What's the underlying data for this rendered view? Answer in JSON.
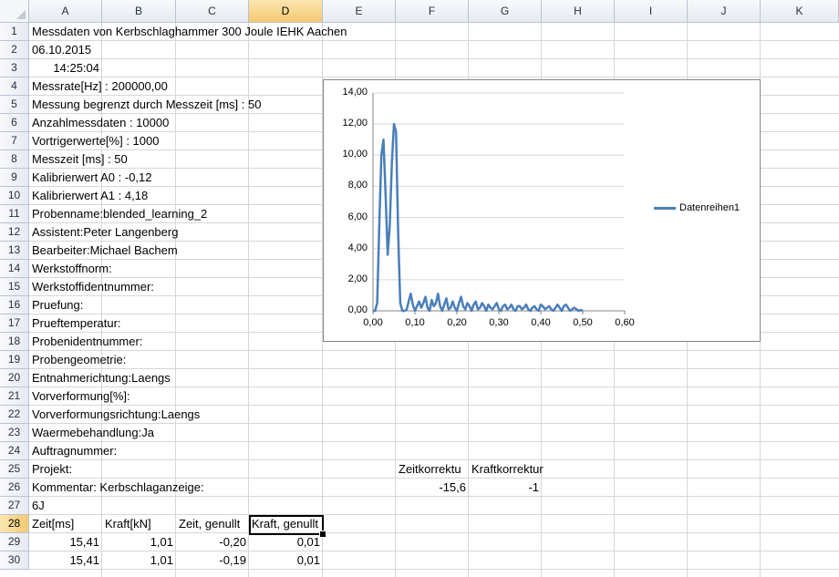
{
  "column_headers": [
    "A",
    "B",
    "C",
    "D",
    "E",
    "F",
    "G",
    "H",
    "I",
    "J",
    "K"
  ],
  "selected_column": "D",
  "row_numbers": [
    "1",
    "2",
    "3",
    "4",
    "5",
    "6",
    "7",
    "8",
    "9",
    "10",
    "11",
    "12",
    "13",
    "14",
    "15",
    "16",
    "17",
    "18",
    "19",
    "20",
    "21",
    "22",
    "23",
    "24",
    "25",
    "26",
    "27",
    "28",
    "29",
    "30"
  ],
  "selected_row": "28",
  "cells": {
    "A1": "Messdaten von Kerbschlaghammer 300 Joule IEHK Aachen",
    "A2": "06.10.2015",
    "A3": "14:25:04",
    "A4": "Messrate[Hz] : 200000,00",
    "A5": "Messung begrenzt durch Messzeit [ms] : 50",
    "A6": "Anzahlmessdaten : 10000",
    "A7": "Vortrigerwerte[%] : 1000",
    "A8": "Messzeit [ms] : 50",
    "A9": "Kalibrierwert A0 : -0,12",
    "A10": "Kalibrierwert A1 : 4,18",
    "A11": "Probenname:blended_learning_2",
    "A12": "Assistent:Peter Langenberg",
    "A13": "Bearbeiter:Michael Bachem",
    "A14": "Werkstoffnorm:",
    "A15": "Werkstoffidentnummer:",
    "A16": "Pruefung:",
    "A17": "Prueftemperatur:",
    "A18": "Probenidentnummer:",
    "A19": "Probengeometrie:",
    "A20": "Entnahmerichtung:Laengs",
    "A21": "Vorverformung[%]:",
    "A22": "Vorverformungsrichtung:Laengs",
    "A23": "Waermebehandlung:Ja",
    "A24": "Auftragnummer:",
    "A25": "Projekt:",
    "F25": "Zeitkorrektu",
    "G25": "Kraftkorrektur",
    "A26": "Kommentar: Kerbschlaganzeige:",
    "F26": "-15,6",
    "G26": "-1",
    "A27": "6J",
    "A28": "Zeit[ms]",
    "B28": "Kraft[kN]",
    "C28": "Zeit, genullt",
    "D28": "Kraft, genullt",
    "A29": "15,41",
    "B29": "1,01",
    "C29": "-0,20",
    "D29": "0,01",
    "A30": "15,41",
    "B30": "1,01",
    "C30": "-0,19",
    "D30": "0,01"
  },
  "chart_data": {
    "type": "line",
    "title": "",
    "xlabel": "",
    "ylabel": "",
    "xlim": [
      0,
      0.6
    ],
    "ylim": [
      0,
      14
    ],
    "x_ticks": [
      "0,00",
      "0,10",
      "0,20",
      "0,30",
      "0,40",
      "0,50",
      "0,60"
    ],
    "y_ticks": [
      "0,00",
      "2,00",
      "4,00",
      "6,00",
      "8,00",
      "10,00",
      "12,00",
      "14,00"
    ],
    "legend_position": "right",
    "series": [
      {
        "name": "Datenreihen1",
        "color": "#4a7ebb",
        "x": [
          0,
          0.005,
          0.01,
          0.015,
          0.02,
          0.025,
          0.03,
          0.035,
          0.04,
          0.045,
          0.05,
          0.055,
          0.06,
          0.065,
          0.07,
          0.075,
          0.08,
          0.085,
          0.09,
          0.095,
          0.1,
          0.105,
          0.11,
          0.115,
          0.12,
          0.125,
          0.13,
          0.135,
          0.14,
          0.145,
          0.15,
          0.155,
          0.16,
          0.165,
          0.17,
          0.175,
          0.18,
          0.185,
          0.19,
          0.195,
          0.2,
          0.205,
          0.21,
          0.215,
          0.22,
          0.225,
          0.23,
          0.235,
          0.24,
          0.245,
          0.25,
          0.255,
          0.26,
          0.265,
          0.27,
          0.275,
          0.28,
          0.285,
          0.29,
          0.295,
          0.3,
          0.305,
          0.31,
          0.315,
          0.32,
          0.325,
          0.33,
          0.335,
          0.34,
          0.345,
          0.35,
          0.355,
          0.36,
          0.365,
          0.37,
          0.375,
          0.38,
          0.385,
          0.39,
          0.395,
          0.4,
          0.405,
          0.41,
          0.415,
          0.42,
          0.425,
          0.43,
          0.435,
          0.44,
          0.445,
          0.45,
          0.455,
          0.46,
          0.465,
          0.47,
          0.475,
          0.48,
          0.485,
          0.49,
          0.495,
          0.5
        ],
        "y": [
          0,
          0,
          0.5,
          5.5,
          10.0,
          11.0,
          7.5,
          3.6,
          5.5,
          9.5,
          12.0,
          11.5,
          5.0,
          0.5,
          0,
          0,
          0.05,
          0.6,
          1.1,
          0.4,
          0,
          0.3,
          0.6,
          0.2,
          0.5,
          0.9,
          0.2,
          0,
          0.7,
          0.3,
          0.5,
          1.1,
          0.3,
          0,
          0.4,
          0.8,
          0.1,
          0.2,
          0.6,
          0.2,
          0,
          0.5,
          0.9,
          0.3,
          0.1,
          0.5,
          0.3,
          0,
          0.4,
          0.6,
          0.1,
          0.2,
          0.5,
          0.3,
          0,
          0.4,
          0.2,
          0.1,
          0.3,
          0.5,
          0.1,
          0,
          0.3,
          0.4,
          0.1,
          0.2,
          0.4,
          0.1,
          0,
          0.3,
          0.3,
          0.1,
          0.2,
          0.4,
          0.1,
          0,
          0.2,
          0.3,
          0.1,
          0,
          0.4,
          0.3,
          0.1,
          0.2,
          0.3,
          0.1,
          0,
          0.2,
          0.4,
          0.2,
          0,
          0.3,
          0.4,
          0.2,
          0,
          0.1,
          0.2,
          0.1,
          0,
          0.05,
          0
        ]
      }
    ]
  }
}
